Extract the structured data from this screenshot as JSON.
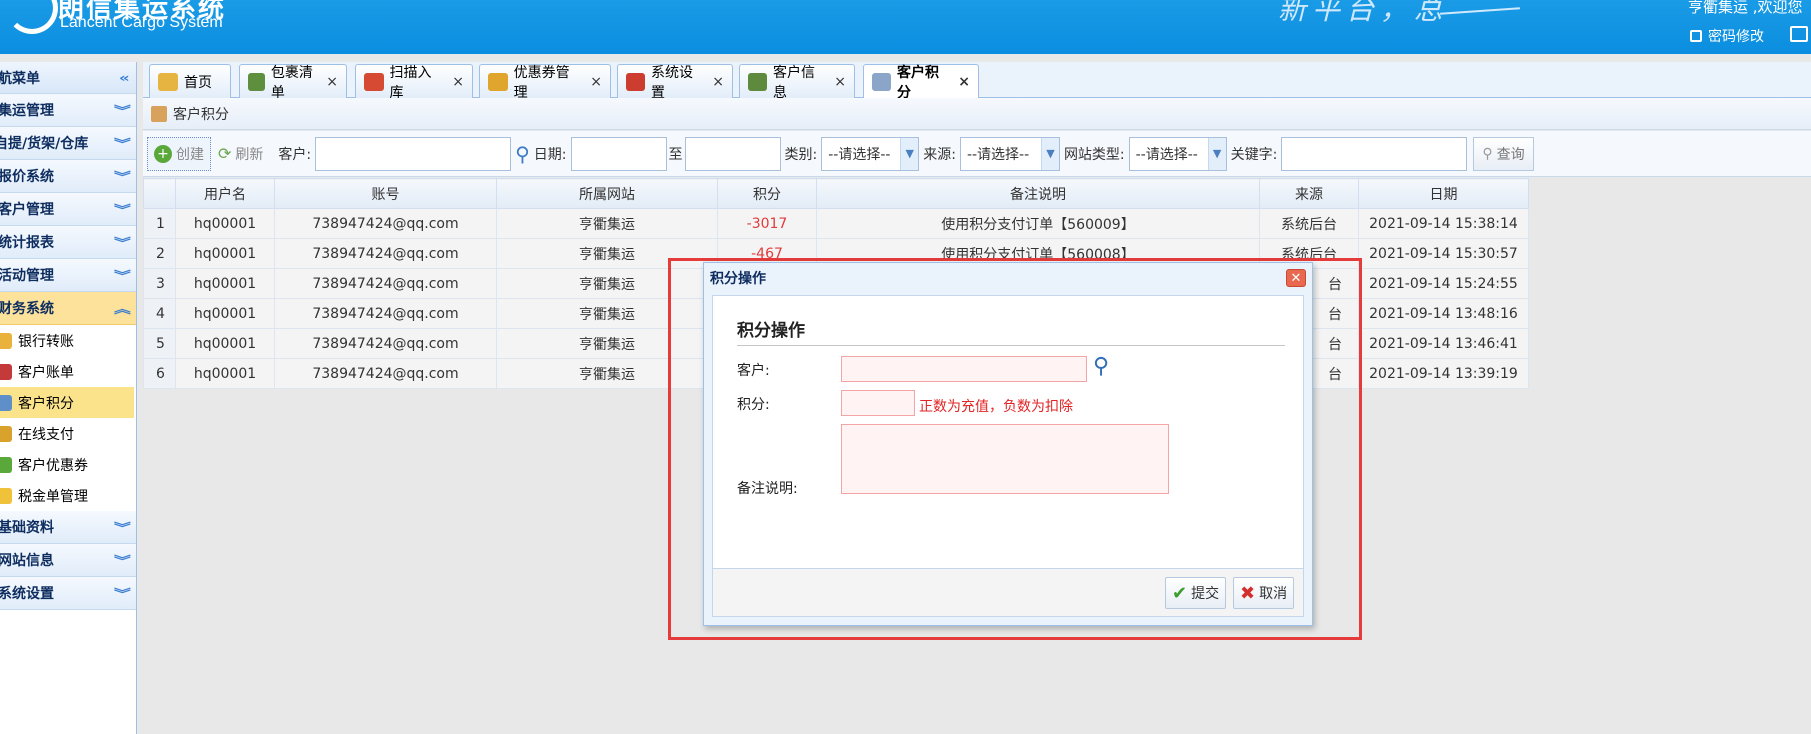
{
  "header": {
    "logo_cn": "朗信集运系统",
    "logo_en": "Lancent Cargo System",
    "slogan": "新平台，总",
    "welcome": "亨衢集运 ,欢迎您",
    "password_link": "密码修改"
  },
  "sidebar": {
    "title": "导航菜单",
    "groups": [
      {
        "label": "集运管理"
      },
      {
        "label": "自提/货架/仓库"
      },
      {
        "label": "报价系统"
      },
      {
        "label": "客户管理"
      },
      {
        "label": "统计报表"
      },
      {
        "label": "活动管理"
      },
      {
        "label": "财务系统"
      }
    ],
    "finance_items": [
      {
        "label": "银行转账",
        "icon_color": "#e8b23c"
      },
      {
        "label": "客户账单",
        "icon_color": "#c43a3a"
      },
      {
        "label": "客户积分",
        "icon_color": "#5f8fc9"
      },
      {
        "label": "在线支付",
        "icon_color": "#d9a22d"
      },
      {
        "label": "客户优惠券",
        "icon_color": "#5aa83a"
      },
      {
        "label": "税金单管理",
        "icon_color": "#f0c23a"
      }
    ],
    "groups_after": [
      {
        "label": "基础资料"
      },
      {
        "label": "网站信息"
      },
      {
        "label": "系统设置"
      }
    ]
  },
  "tabs": [
    {
      "label": "首页",
      "icon": "home-icon",
      "color": "#e6b440"
    },
    {
      "label": "包裹清单",
      "icon": "truck-icon",
      "color": "#5e8f3e"
    },
    {
      "label": "扫描入库",
      "icon": "scan-icon",
      "color": "#d64a33"
    },
    {
      "label": "优惠券管理",
      "icon": "crown-icon",
      "color": "#e0a52d"
    },
    {
      "label": "系统设置",
      "icon": "settings-icon",
      "color": "#cc3d2f"
    },
    {
      "label": "客户信息",
      "icon": "user-icon",
      "color": "#5d8a3d"
    },
    {
      "label": "客户积分",
      "icon": "calculator-icon",
      "color": "#8aa5c8"
    }
  ],
  "panel": {
    "title": "客户积分"
  },
  "toolbar": {
    "create": "创建",
    "refresh": "刷新",
    "customer_label": "客户:",
    "date_label": "日期:",
    "to_label": "至",
    "category_label": "类别:",
    "category_value": "--请选择--",
    "source_label": "来源:",
    "source_value": "--请选择--",
    "site_type_label": "网站类型:",
    "site_type_value": "--请选择--",
    "keyword_label": "关键字:",
    "query": "查询"
  },
  "grid": {
    "columns": [
      "用户名",
      "账号",
      "所属网站",
      "积分",
      "备注说明",
      "来源",
      "日期"
    ],
    "rows": [
      {
        "n": "1",
        "user": "hq00001",
        "account": "738947424@qq.com",
        "site": "亨衢集运",
        "points": "-3017",
        "remark": "使用积分支付订单【560009】",
        "source": "系统后台",
        "date": "2021-09-14 15:38:14"
      },
      {
        "n": "2",
        "user": "hq00001",
        "account": "738947424@qq.com",
        "site": "亨衢集运",
        "points": "-467",
        "remark": "使用积分支付订单【560008】",
        "source": "系统后台",
        "date": "2021-09-14 15:30:57"
      },
      {
        "n": "3",
        "user": "hq00001",
        "account": "738947424@qq.com",
        "site": "亨衢集运",
        "points": "",
        "remark": "",
        "source": "台",
        "date": "2021-09-14 15:24:55"
      },
      {
        "n": "4",
        "user": "hq00001",
        "account": "738947424@qq.com",
        "site": "亨衢集运",
        "points": "",
        "remark": "",
        "source": "台",
        "date": "2021-09-14 13:48:16"
      },
      {
        "n": "5",
        "user": "hq00001",
        "account": "738947424@qq.com",
        "site": "亨衢集运",
        "points": "",
        "remark": "",
        "source": "台",
        "date": "2021-09-14 13:46:41"
      },
      {
        "n": "6",
        "user": "hq00001",
        "account": "738947424@qq.com",
        "site": "亨衢集运",
        "points": "",
        "remark": "",
        "source": "台",
        "date": "2021-09-14 13:39:19"
      }
    ]
  },
  "dialog": {
    "title": "积分操作",
    "heading": "积分操作",
    "customer_label": "客户:",
    "points_label": "积分:",
    "points_hint": "正数为充值，负数为扣除",
    "remark_label": "备注说明:",
    "submit": "提交",
    "cancel": "取消"
  }
}
